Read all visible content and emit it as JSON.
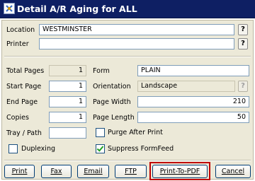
{
  "window": {
    "title": "Detail A/R Aging for ALL"
  },
  "location": {
    "label": "Location",
    "value": "WESTMINSTER",
    "lookup": "?"
  },
  "printer": {
    "label": "Printer",
    "value": "",
    "lookup": "?"
  },
  "left": {
    "total_pages": {
      "label": "Total Pages",
      "value": "1"
    },
    "start_page": {
      "label": "Start Page",
      "value": "1"
    },
    "end_page": {
      "label": "End Page",
      "value": "1"
    },
    "copies": {
      "label": "Copies",
      "value": "1"
    },
    "tray_path": {
      "label": "Tray / Path",
      "value": ""
    },
    "duplexing": {
      "label": "Duplexing",
      "checked": false
    }
  },
  "right": {
    "form": {
      "label": "Form",
      "value": "PLAIN"
    },
    "orientation": {
      "label": "Orientation",
      "value": "Landscape",
      "lookup": "?"
    },
    "page_width": {
      "label": "Page Width",
      "value": "210"
    },
    "page_length": {
      "label": "Page Length",
      "value": "50"
    },
    "purge_after_print": {
      "label": "Purge After Print",
      "checked": false
    },
    "suppress_formfeed": {
      "label": "Suppress FormFeed",
      "checked": true
    }
  },
  "buttons": {
    "print": "Print",
    "fax": "Fax",
    "email": "Email",
    "ftp": "FTP",
    "print_to_pdf": "Print-To-PDF",
    "cancel": "Cancel"
  },
  "colors": {
    "titlebar": "#0e1f63",
    "highlight": "#c00000",
    "checkmark": "#21a121"
  }
}
